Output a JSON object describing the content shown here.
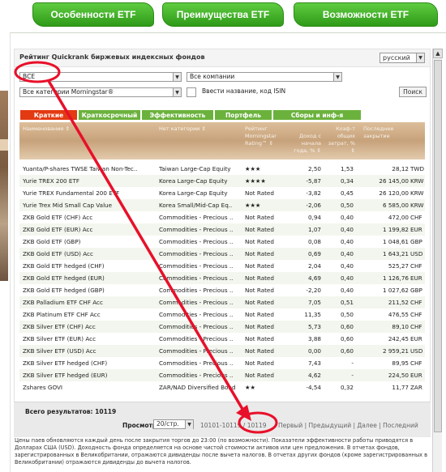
{
  "nav": {
    "item1": "Особенности ETF",
    "item2": "Преимущества ETF",
    "item3": "Возможности ETF"
  },
  "panel": {
    "title": "Рейтинг Quickrank биржевых индексных фондов",
    "language": "русский"
  },
  "filters": {
    "type": "ВСЕ",
    "companies": "Все компании",
    "category": "Все категории Morningstar®",
    "isin_placeholder": "Ввести название, код ISIN",
    "search_label": "Поиск"
  },
  "tabs": [
    "Краткие сведения",
    "Краткосрочный",
    "Эффективность",
    "Портфель",
    "Сборы и инф-я"
  ],
  "columns": {
    "name": "Наименование ⇕",
    "category": "Нет категории ⇕",
    "rating": "Рейтинг Morningstar Rating™ ⇕",
    "return": "Доход с начала года, % ⇕",
    "cost": "Коэф-т общих затрат, % ⇕",
    "close": "Последнее закрытие"
  },
  "rows": [
    {
      "name": "Yuanta/P-shares TWSE Taiwan Non-Tec..",
      "category": "Taiwan Large-Cap Equity",
      "rating": "★★★",
      "ret": "2,50",
      "cost": "1,53",
      "close": "28,12",
      "cur": "TWD"
    },
    {
      "name": "Yurie TREX 200 ETF",
      "category": "Korea Large-Cap Equity",
      "rating": "★★★★",
      "ret": "-5,87",
      "cost": "0,34",
      "close": "26 145,00",
      "cur": "KRW"
    },
    {
      "name": "Yurie TREX Fundamental 200 ETF",
      "category": "Korea Large-Cap Equity",
      "rating": "Not Rated",
      "ret": "-3,82",
      "cost": "0,45",
      "close": "26 120,00",
      "cur": "KRW"
    },
    {
      "name": "Yurie Trex Mid Small Cap Value",
      "category": "Korea Small/Mid-Cap Eq..",
      "rating": "★★★",
      "ret": "-2,06",
      "cost": "0,50",
      "close": "6 585,00",
      "cur": "KRW"
    },
    {
      "name": "ZKB Gold ETF (CHF) Acc",
      "category": "Commodities - Precious ..",
      "rating": "Not Rated",
      "ret": "0,94",
      "cost": "0,40",
      "close": "472,00",
      "cur": "CHF"
    },
    {
      "name": "ZKB Gold ETF (EUR) Acc",
      "category": "Commodities - Precious ..",
      "rating": "Not Rated",
      "ret": "1,07",
      "cost": "0,40",
      "close": "1 199,82",
      "cur": "EUR"
    },
    {
      "name": "ZKB Gold ETF (GBP)",
      "category": "Commodities - Precious ..",
      "rating": "Not Rated",
      "ret": "0,08",
      "cost": "0,40",
      "close": "1 048,61",
      "cur": "GBP"
    },
    {
      "name": "ZKB Gold ETF (USD) Acc",
      "category": "Commodities - Precious ..",
      "rating": "Not Rated",
      "ret": "0,69",
      "cost": "0,40",
      "close": "1 643,21",
      "cur": "USD"
    },
    {
      "name": "ZKB Gold ETF hedged (CHF)",
      "category": "Commodities - Precious ..",
      "rating": "Not Rated",
      "ret": "2,04",
      "cost": "0,40",
      "close": "525,27",
      "cur": "CHF"
    },
    {
      "name": "ZKB Gold ETF hedged (EUR)",
      "category": "Commodities - Precious ..",
      "rating": "Not Rated",
      "ret": "4,69",
      "cost": "0,40",
      "close": "1 126,76",
      "cur": "EUR"
    },
    {
      "name": "ZKB Gold ETF hedged (GBP)",
      "category": "Commodities - Precious ..",
      "rating": "Not Rated",
      "ret": "-2,20",
      "cost": "0,40",
      "close": "1 027,62",
      "cur": "GBP"
    },
    {
      "name": "ZKB Palladium ETF CHF Acc",
      "category": "Commodities - Precious ..",
      "rating": "Not Rated",
      "ret": "7,05",
      "cost": "0,51",
      "close": "211,52",
      "cur": "CHF"
    },
    {
      "name": "ZKB Platinum ETF CHF Acc",
      "category": "Commodities - Precious ..",
      "rating": "Not Rated",
      "ret": "11,35",
      "cost": "0,50",
      "close": "476,55",
      "cur": "CHF"
    },
    {
      "name": "ZKB Silver ETF (CHF) Acc",
      "category": "Commodities - Precious ..",
      "rating": "Not Rated",
      "ret": "5,73",
      "cost": "0,60",
      "close": "89,10",
      "cur": "CHF"
    },
    {
      "name": "ZKB Silver ETF (EUR) Acc",
      "category": "Commodities - Precious ..",
      "rating": "Not Rated",
      "ret": "3,88",
      "cost": "0,60",
      "close": "242,45",
      "cur": "EUR"
    },
    {
      "name": "ZKB Silver ETF (USD) Acc",
      "category": "Commodities - Precious ..",
      "rating": "Not Rated",
      "ret": "0,00",
      "cost": "0,60",
      "close": "2 959,21",
      "cur": "USD"
    },
    {
      "name": "ZKB Silver ETF hedged (CHF)",
      "category": "Commodities - Precious ..",
      "rating": "Not Rated",
      "ret": "7,43",
      "cost": "-",
      "close": "89,95",
      "cur": "CHF"
    },
    {
      "name": "ZKB Silver ETF hedged (EUR)",
      "category": "Commodities - Precious ..",
      "rating": "Not Rated",
      "ret": "4,62",
      "cost": "-",
      "close": "224,50",
      "cur": "EUR"
    },
    {
      "name": "Zshares GOVI",
      "category": "ZAR/NAD Diversified Bond",
      "rating": "★★",
      "ret": "-4,54",
      "cost": "0,32",
      "close": "11,77",
      "cur": "ZAR"
    }
  ],
  "summary": {
    "total_label": "Всего результатов: 10119",
    "view_label": "Просмотр:",
    "per_page": "20/стр.",
    "range": "10101-10119 / 10119",
    "pages": "Первый | Предыдущий | Далее | Последний"
  },
  "footnote": "Цены паев обновляются каждый день после закрытия торгов до 23:00 (по возможности). Показатели эффективности работы приводятся в Долларах США (USD). Доходность фонда определяется на основе чистой стоимости активов или цен предложения. В отчетах фондов, зарегистрированных в Великобритании, отражаются дивиденды после вычета налогов. В отчетах других фондов (кроме зарегистрированных в Великобритании) отражаются дивиденды до вычета налогов.",
  "colors": {
    "nav_green": "#3aab20",
    "tab_green": "#6bb23d",
    "tab_active": "#e33a12",
    "annotation_red": "#e8102a"
  }
}
